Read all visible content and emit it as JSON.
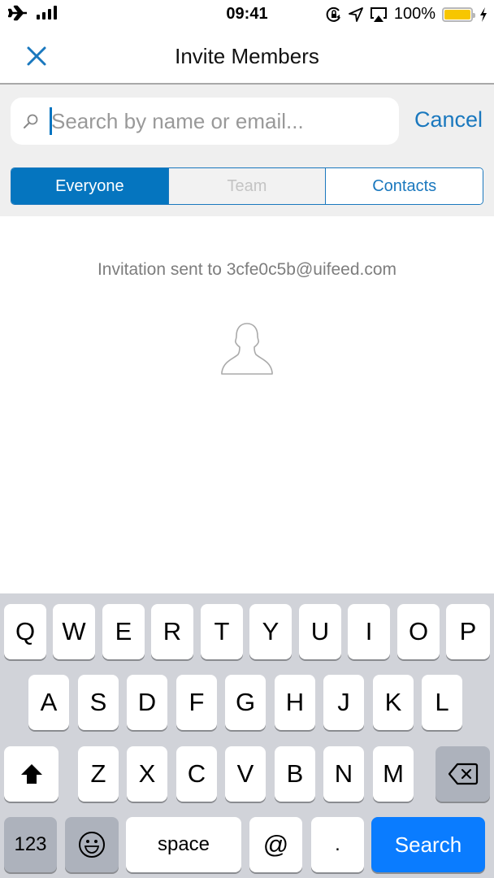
{
  "status_bar": {
    "time": "09:41",
    "battery_percent": "100%",
    "battery_level": 1.0,
    "left_icons": [
      "airplane-icon",
      "signal-icon"
    ],
    "right_icons": [
      "orientation-lock-icon",
      "location-icon",
      "airplay-icon",
      "battery-icon",
      "charging-icon"
    ]
  },
  "navbar": {
    "title": "Invite Members",
    "close_icon": "close-icon"
  },
  "search": {
    "placeholder": "Search by name or email...",
    "value": "",
    "cancel_label": "Cancel"
  },
  "segments": [
    {
      "label": "Everyone",
      "state": "active"
    },
    {
      "label": "Team",
      "state": "disabled"
    },
    {
      "label": "Contacts",
      "state": "normal"
    }
  ],
  "content": {
    "message": "Invitation sent to 3cfe0c5b@uifeed.com",
    "icon": "person-icon"
  },
  "keyboard": {
    "row1": [
      "Q",
      "W",
      "E",
      "R",
      "T",
      "Y",
      "U",
      "I",
      "O",
      "P"
    ],
    "row2": [
      "A",
      "S",
      "D",
      "F",
      "G",
      "H",
      "J",
      "K",
      "L"
    ],
    "row3": [
      "Z",
      "X",
      "C",
      "V",
      "B",
      "N",
      "M"
    ],
    "numbers_label": "123",
    "space_label": "space",
    "at_label": "@",
    "dot_label": ".",
    "search_label": "Search"
  },
  "colors": {
    "accent": "#0575bf",
    "keyboard_action": "#0a7cff",
    "battery": "#f7c600"
  }
}
